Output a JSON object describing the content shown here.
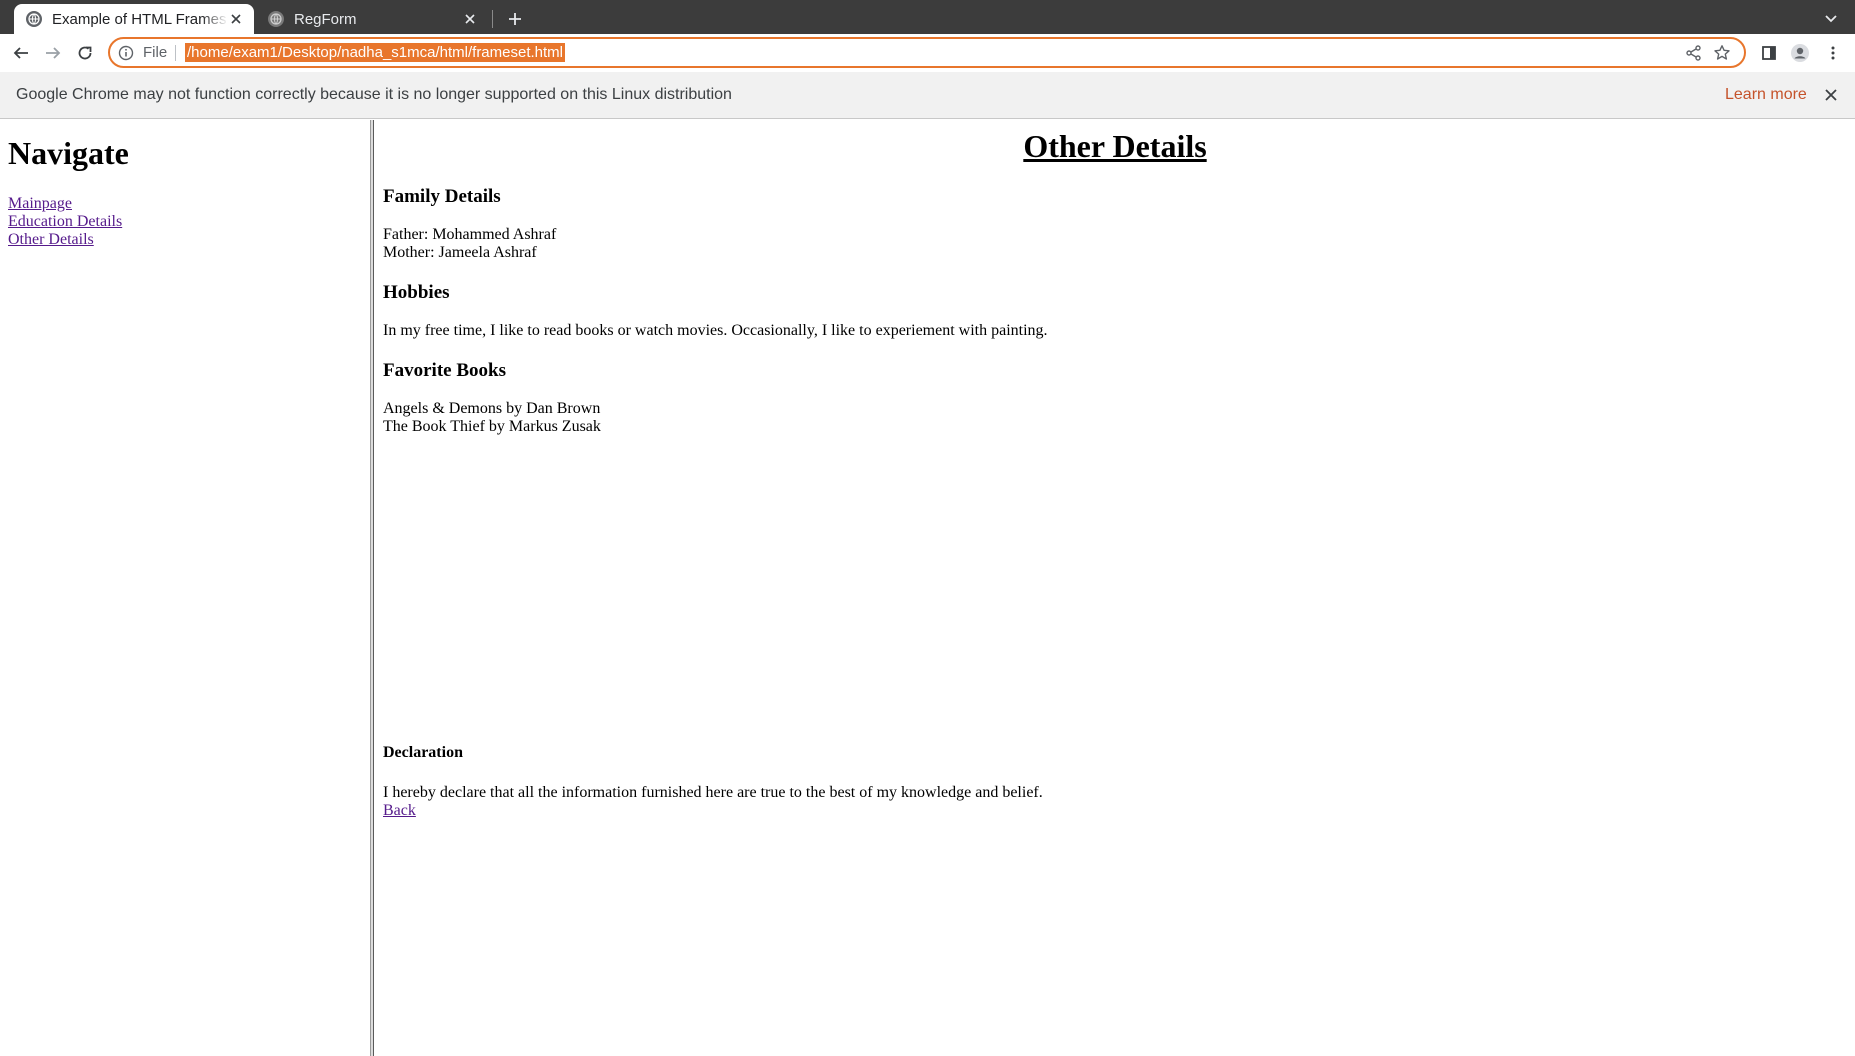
{
  "browser": {
    "tabs": [
      {
        "title": "Example of HTML Frames",
        "active": true
      },
      {
        "title": "RegForm",
        "active": false
      }
    ],
    "omnibox": {
      "scheme_label": "File",
      "url": "/home/exam1/Desktop/nadha_s1mca/html/frameset.html"
    },
    "infobar": {
      "message": "Google Chrome may not function correctly because it is no longer supported on this Linux distribution",
      "learn_more": "Learn more"
    }
  },
  "left_frame": {
    "heading": "Navigate",
    "links": [
      "Mainpage",
      "Education Details",
      "Other Details"
    ]
  },
  "right_frame": {
    "title": "Other Details",
    "family": {
      "heading": "Family Details",
      "father": "Father: Mohammed Ashraf",
      "mother": "Mother: Jameela Ashraf"
    },
    "hobbies": {
      "heading": "Hobbies",
      "text": "In my free time, I like to read books or watch movies. Occasionally, I like to experiement with painting."
    },
    "books": {
      "heading": "Favorite Books",
      "items": [
        "Angels & Demons by Dan Brown",
        "The Book Thief by Markus Zusak"
      ]
    },
    "declaration": {
      "heading": "Declaration",
      "text": "I hereby declare that all the information furnished here are true to the best of my knowledge and belief."
    },
    "back_link": "Back"
  }
}
